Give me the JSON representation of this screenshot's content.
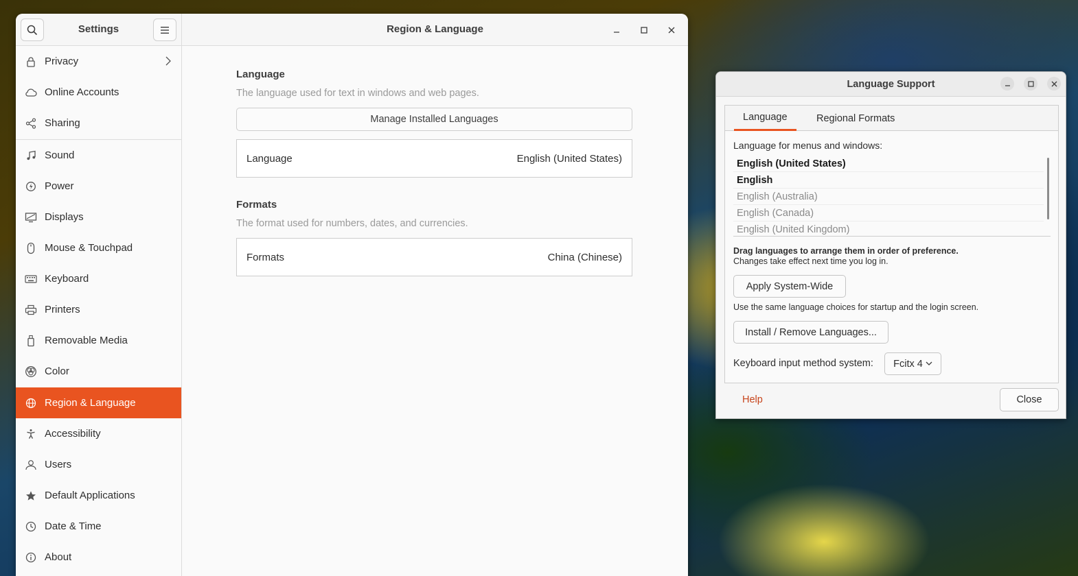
{
  "settings": {
    "sidebar_title": "Settings",
    "page_title": "Region & Language",
    "nav_items": [
      {
        "label": "Privacy",
        "icon": "lock-icon"
      },
      {
        "label": "Online Accounts",
        "icon": "cloud-icon"
      },
      {
        "label": "Sharing",
        "icon": "share-icon"
      },
      {
        "label": "Sound",
        "icon": "music-note-icon"
      },
      {
        "label": "Power",
        "icon": "power-icon"
      },
      {
        "label": "Displays",
        "icon": "display-icon"
      },
      {
        "label": "Mouse & Touchpad",
        "icon": "mouse-icon"
      },
      {
        "label": "Keyboard",
        "icon": "keyboard-icon"
      },
      {
        "label": "Printers",
        "icon": "printer-icon"
      },
      {
        "label": "Removable Media",
        "icon": "usb-drive-icon"
      },
      {
        "label": "Color",
        "icon": "color-icon"
      },
      {
        "label": "Region & Language",
        "icon": "globe-icon",
        "active": true
      },
      {
        "label": "Accessibility",
        "icon": "accessibility-icon"
      },
      {
        "label": "Users",
        "icon": "user-icon"
      },
      {
        "label": "Default Applications",
        "icon": "star-icon"
      },
      {
        "label": "Date & Time",
        "icon": "clock-icon"
      },
      {
        "label": "About",
        "icon": "info-icon"
      }
    ],
    "language_section": {
      "title": "Language",
      "description": "The language used for text in windows and web pages.",
      "manage_button": "Manage Installed Languages",
      "row_label": "Language",
      "row_value": "English (United States)"
    },
    "formats_section": {
      "title": "Formats",
      "description": "The format used for numbers, dates, and currencies.",
      "row_label": "Formats",
      "row_value": "China (Chinese)"
    }
  },
  "language_support": {
    "title": "Language Support",
    "tabs": [
      "Language",
      "Regional Formats"
    ],
    "active_tab": "Language",
    "list_label": "Language for menus and windows:",
    "languages": [
      {
        "name": "English (United States)",
        "style": "bold"
      },
      {
        "name": "English",
        "style": "bold"
      },
      {
        "name": "English (Australia)",
        "style": "dim"
      },
      {
        "name": "English (Canada)",
        "style": "dim"
      },
      {
        "name": "English (United Kingdom)",
        "style": "dim"
      }
    ],
    "drag_hint": "Drag languages to arrange them in order of preference.",
    "drag_note": "Changes take effect next time you log in.",
    "apply_button": "Apply System-Wide",
    "apply_note": "Use the same language choices for startup and the login screen.",
    "install_button": "Install / Remove Languages...",
    "im_label": "Keyboard input method system:",
    "im_value": "Fcitx 4",
    "help_link": "Help",
    "close_button": "Close"
  },
  "colors": {
    "accent": "#e95420",
    "help_link": "#c7441b"
  }
}
